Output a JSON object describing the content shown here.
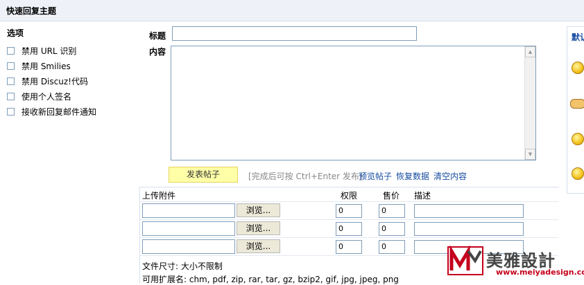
{
  "header": {
    "title": "快速回复主题"
  },
  "options": {
    "title": "选项",
    "items": [
      "禁用 URL 识别",
      "禁用 Smilies",
      "禁用 Discuz!代码",
      "使用个人签名",
      "接收新回复邮件通知"
    ]
  },
  "form": {
    "subject_label": "标题",
    "subject_value": "",
    "content_label": "内容",
    "content_value": ""
  },
  "actions": {
    "submit": "发表帖子",
    "hint": "[完成后可按 Ctrl+Enter 发布]",
    "preview": "预览帖子",
    "restore": "恢复数据",
    "clear": "清空内容"
  },
  "attachments": {
    "headers": {
      "upload": "上传附件",
      "permission": "权限",
      "price": "售价",
      "description": "描述"
    },
    "rows": [
      {
        "browse": "浏览...",
        "permission": "0",
        "price": "0",
        "description": ""
      },
      {
        "browse": "浏览...",
        "permission": "0",
        "price": "0",
        "description": ""
      },
      {
        "browse": "浏览...",
        "permission": "0",
        "price": "0",
        "description": ""
      }
    ],
    "file_size": "文件尺寸: 大小不限制",
    "extensions": "可用扩展名: chm, pdf, zip, rar, tar, gz, bzip2, gif, jpg, jpeg, png"
  },
  "smilies_panel": {
    "title": "默认"
  },
  "watermark": {
    "brand": "美雅設計",
    "url": "www.meiyadesign.com"
  },
  "colors": {
    "header_bg": "#eef2f8",
    "link": "#154ba0",
    "submit_bg": "#ffffa8",
    "watermark_red": "#c4001c"
  }
}
